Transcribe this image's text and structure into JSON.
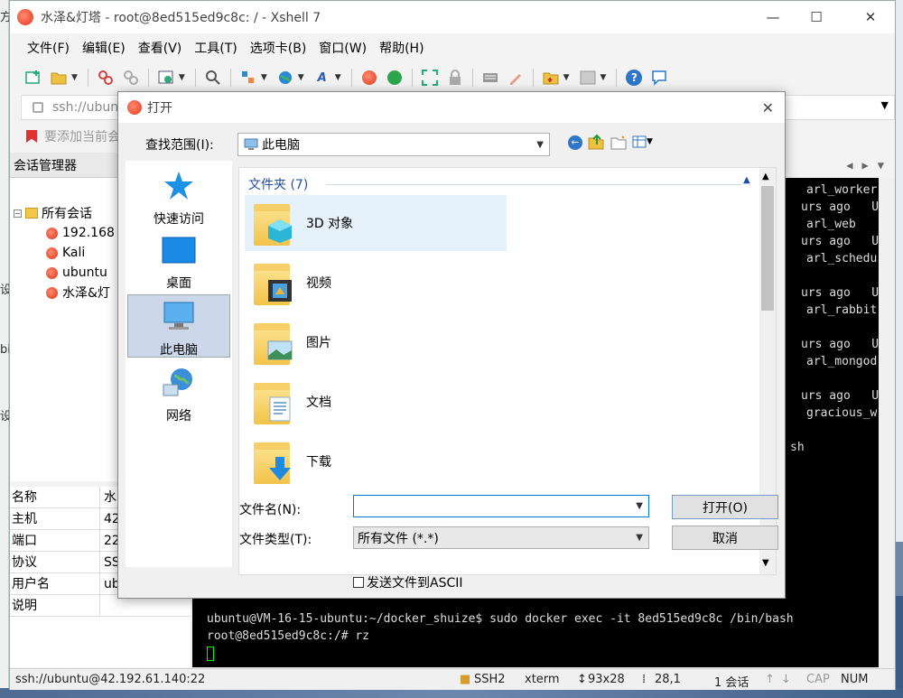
{
  "window": {
    "title": "水泽&灯塔 - root@8ed515ed9c8c: / - Xshell 7",
    "minimize": "—",
    "maximize": "☐",
    "close": "✕"
  },
  "menu": [
    "文件(F)",
    "编辑(E)",
    "查看(V)",
    "工具(T)",
    "选项卡(B)",
    "窗口(W)",
    "帮助(H)"
  ],
  "address": {
    "value": "ssh://ubun"
  },
  "hint": {
    "text": "要添加当前会"
  },
  "desktop_glyphs": [
    "方",
    "设",
    "bi",
    "设"
  ],
  "session_manager": {
    "title": "会话管理器",
    "root": "所有会话",
    "sessions": [
      "192.168",
      "Kali",
      "ubuntu",
      "水泽&灯"
    ]
  },
  "properties": [
    {
      "key": "名称",
      "value": "水"
    },
    {
      "key": "主机",
      "value": "42"
    },
    {
      "key": "端口",
      "value": "22"
    },
    {
      "key": "协议",
      "value": "SS"
    },
    {
      "key": "用户名",
      "value": "ub"
    },
    {
      "key": "说明",
      "value": ""
    }
  ],
  "terminal": {
    "lines": [
      "arl_worker",
      "urs ago   Up",
      "arl_web",
      "urs ago   Up",
      "arl_schedu",
      "",
      "urs ago   Up",
      "arl_rabbit",
      "",
      "urs ago   Up",
      "arl_mongod",
      "",
      "urs ago   Up",
      "gracious_w",
      "",
      "sh"
    ],
    "command_line": "ubuntu@VM-16-15-ubuntu:~/docker_shuize$ sudo docker exec -it 8ed515ed9c8c /bin/bash",
    "prompt_line": "root@8ed515ed9c8c:/# rz"
  },
  "status": {
    "connection": "ssh://ubuntu@42.192.61.140:22",
    "protocol": "SSH2",
    "term": "xterm",
    "size": "93x28",
    "cursor": "28,1",
    "sessions": "1 会话",
    "cap": "CAP",
    "num": "NUM"
  },
  "dialog": {
    "title": "打开",
    "look_in_label": "查找范围(I):",
    "look_in_value": "此电脑",
    "places": [
      {
        "label": "快速访问",
        "icon": "star-icon"
      },
      {
        "label": "桌面",
        "icon": "desktop-icon"
      },
      {
        "label": "此电脑",
        "icon": "computer-icon"
      },
      {
        "label": "网络",
        "icon": "network-icon"
      }
    ],
    "group_header": "文件夹 (7)",
    "folders": [
      {
        "name": "3D 对象",
        "icon": "3d-objects-icon"
      },
      {
        "name": "视频",
        "icon": "video-icon"
      },
      {
        "name": "图片",
        "icon": "pictures-icon"
      },
      {
        "name": "文档",
        "icon": "documents-icon"
      },
      {
        "name": "下载",
        "icon": "downloads-icon"
      }
    ],
    "filename_label": "文件名(N):",
    "filename_value": "",
    "filetype_label": "文件类型(T):",
    "filetype_value": "所有文件 (*.*)",
    "open_button": "打开(O)",
    "cancel_button": "取消",
    "ascii_checkbox": "发送文件到ASCII",
    "ascii_checked": false
  }
}
